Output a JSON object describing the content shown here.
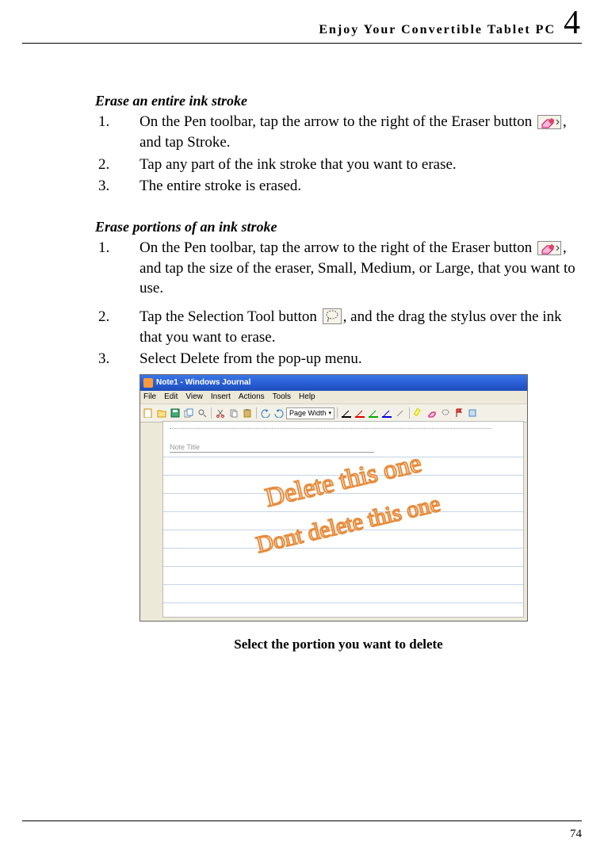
{
  "header": {
    "title": "Enjoy Your Convertible Tablet PC",
    "chapter_number": "4"
  },
  "section1": {
    "title": "Erase an entire ink stroke",
    "steps": [
      {
        "pre": "On the Pen toolbar, tap the arrow to the right of the Eraser button ",
        "post": ", and tap Stroke."
      },
      {
        "text": "Tap any part of the ink stroke that you want to erase."
      },
      {
        "text": "The entire stroke is erased."
      }
    ]
  },
  "section2": {
    "title": "Erase portions of an ink stroke",
    "steps": [
      {
        "pre": "On the Pen toolbar, tap the arrow to the right of the Eraser button ",
        "post": ", and tap the size of the eraser, Small, Medium, or Large, that you want to use."
      },
      {
        "pre": "Tap the Selection Tool button ",
        "post": ", and the drag the stylus over the ink that you want to erase."
      },
      {
        "text": "Select Delete from the pop-up menu."
      }
    ]
  },
  "journal": {
    "title": "Note1 - Windows Journal",
    "menus": [
      "File",
      "Edit",
      "View",
      "Insert",
      "Actions",
      "Tools",
      "Help"
    ],
    "zoom": "Page Width",
    "note_title_placeholder": "Note Title",
    "ink_lines": [
      "Delete this one",
      "Dont delete this one"
    ]
  },
  "caption": "Select the portion you want to delete",
  "page_number": "74"
}
